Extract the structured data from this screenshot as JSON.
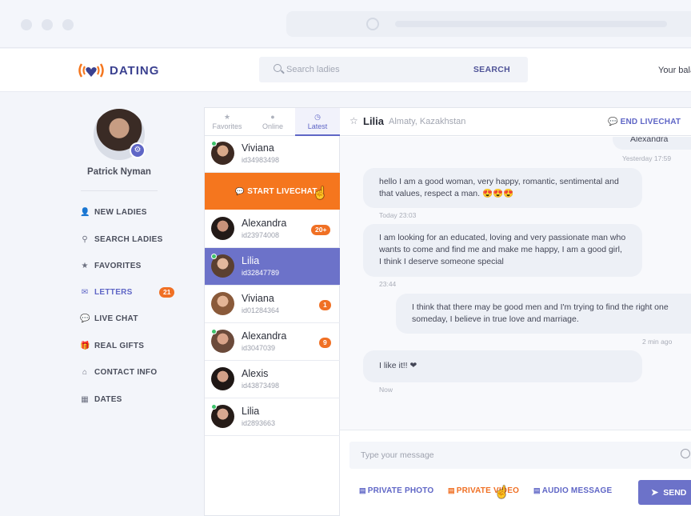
{
  "header": {
    "logo_text": "DATING",
    "search_placeholder": "Search ladies",
    "search_button": "SEARCH",
    "balance_text": "Your bala"
  },
  "profile": {
    "name": "Patrick Nyman"
  },
  "nav": [
    {
      "label": "NEW LADIES",
      "icon": "add-user-icon"
    },
    {
      "label": "SEARCH LADIES",
      "icon": "search-icon"
    },
    {
      "label": "FAVORITES",
      "icon": "star-icon"
    },
    {
      "label": "LETTERS",
      "icon": "envelope-icon",
      "badge": "21"
    },
    {
      "label": "LIVE CHAT",
      "icon": "chat-icon"
    },
    {
      "label": "REAL GIFTS",
      "icon": "gift-icon"
    },
    {
      "label": "CONTACT INFO",
      "icon": "home-icon"
    },
    {
      "label": "DATES",
      "icon": "calendar-icon"
    }
  ],
  "tabs": [
    {
      "label": "Favorites"
    },
    {
      "label": "Online"
    },
    {
      "label": "Latest"
    }
  ],
  "contacts": [
    {
      "name": "Viviana",
      "id": "id34983498",
      "online": true,
      "badge": ""
    },
    {
      "name": "Alexandra",
      "id": "id23974008",
      "online": false,
      "badge": "20+"
    },
    {
      "name": "Lilia",
      "id": "id32847789",
      "online": true,
      "badge": "",
      "selected": true
    },
    {
      "name": "Viviana",
      "id": "id01284364",
      "online": false,
      "badge": "1"
    },
    {
      "name": "Alexandra",
      "id": "id3047039",
      "online": true,
      "badge": "9"
    },
    {
      "name": "Alexis",
      "id": "id43873498",
      "online": false,
      "badge": ""
    },
    {
      "name": "Lilia",
      "id": "id2893663",
      "online": true,
      "badge": ""
    }
  ],
  "livechat_label": "START LIVECHAT",
  "chat": {
    "name": "Lilia",
    "location": "Almaty, Kazakhstan",
    "end_label": "END LIVECHAT",
    "messages": [
      {
        "text": "Alexandra",
        "time": "Yesterday 17:59"
      },
      {
        "text": "hello I am a good woman, very happy, romantic, sentimental and that values, respect a man. 😍😍😍",
        "time": "Today 23:03"
      },
      {
        "text": "I am looking for an educated, loving and very passionate man who wants to come and find me and make me happy, I am a good girl, I think I deserve someone special",
        "time": "23:44"
      },
      {
        "text": "I think that there may be good men and I'm trying to find the right one someday, I believe in true love and marriage.",
        "time": "2 min ago"
      },
      {
        "text": "I like it!! ❤",
        "time": "Now"
      }
    ],
    "input_placeholder": "Type your message",
    "actions": {
      "photo": "PRIVATE PHOTO",
      "video": "PRIVATE VIDEO",
      "audio": "AUDIO MESSAGE"
    },
    "send_label": "SEND"
  },
  "colors": {
    "brand": "#3b4190",
    "accent": "#5f66c6",
    "orange": "#f5761e"
  }
}
